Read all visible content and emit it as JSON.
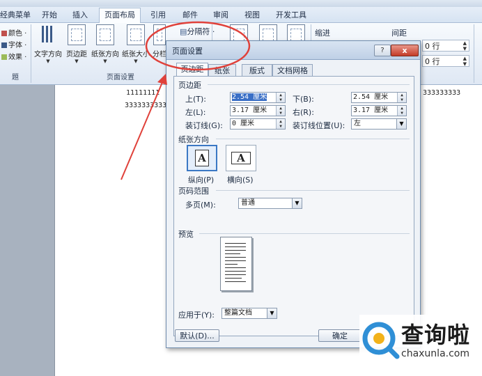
{
  "ribbon_tabs": [
    {
      "label": "经典菜单"
    },
    {
      "label": "开始"
    },
    {
      "label": "插入"
    },
    {
      "label": "页面布局"
    },
    {
      "label": "引用"
    },
    {
      "label": "邮件"
    },
    {
      "label": "审阅"
    },
    {
      "label": "视图"
    },
    {
      "label": "开发工具"
    }
  ],
  "ribbon": {
    "theme_items": [
      "颜色 ·",
      "字体 ·",
      "效果 ·"
    ],
    "buttons": [
      {
        "label": "文字方向",
        "icon": "text-direction-icon"
      },
      {
        "label": "页边距",
        "icon": "margins-icon"
      },
      {
        "label": "纸张方向",
        "icon": "orientation-icon"
      },
      {
        "label": "纸张大小",
        "icon": "paper-size-icon"
      },
      {
        "label": "分栏",
        "icon": "columns-icon"
      }
    ],
    "breaks_label": "分隔符 ·",
    "group_page_setup": "页面设置",
    "indent_label": "缩进",
    "spacing_label": "间距",
    "spacing_before": "0 行",
    "spacing_after": "0 行"
  },
  "document": {
    "line1": "11111111",
    "line1_tail": "333333333",
    "line2": "3333333333"
  },
  "dialog": {
    "title": "页面设置",
    "help": "?",
    "close": "x",
    "tabs": [
      "页边距",
      "纸张",
      "版式",
      "文档网格"
    ],
    "margins_section": "页边距",
    "top_label": "上(T):",
    "top_value": "2.54 厘米",
    "bottom_label": "下(B):",
    "bottom_value": "2.54 厘米",
    "left_label": "左(L):",
    "left_value": "3.17 厘米",
    "right_label": "右(R):",
    "right_value": "3.17 厘米",
    "gutter_label": "装订线(G):",
    "gutter_value": "0 厘米",
    "gutter_pos_label": "装订线位置(U):",
    "gutter_pos_value": "左",
    "orientation_section": "纸张方向",
    "portrait_label": "纵向(P)",
    "landscape_label": "横向(S)",
    "orientation_glyph": "A",
    "pages_section": "页码范围",
    "multiple_pages_label": "多页(M):",
    "multiple_pages_value": "普通",
    "preview_section": "预览",
    "apply_to_label": "应用于(Y):",
    "apply_to_value": "整篇文档",
    "default_button": "默认(D)...",
    "ok_button": "确定"
  },
  "watermark": {
    "text": "查询啦",
    "url": "chaxunla.com"
  },
  "colors": {
    "annotation": "#e0413a",
    "accent": "#3b78c4"
  }
}
